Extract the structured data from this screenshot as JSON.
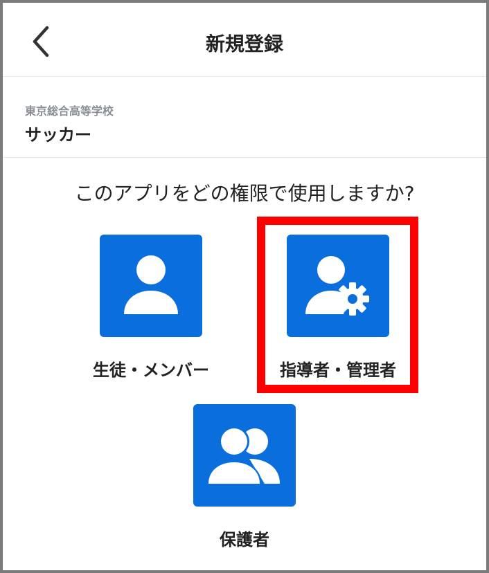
{
  "header": {
    "title": "新規登録",
    "back_icon": "chevron-left-icon"
  },
  "school": {
    "name": "東京総合高等学校",
    "team": "サッカー"
  },
  "question": "このアプリをどの権限で使用しますか?",
  "roles": [
    {
      "label": "生徒・メンバー",
      "icon": "person-icon"
    },
    {
      "label": "指導者・管理者",
      "icon": "person-gear-icon"
    },
    {
      "label": "保護者",
      "icon": "people-icon"
    }
  ],
  "colors": {
    "tile": "#0a6fdd",
    "highlight": "#ff0000"
  }
}
